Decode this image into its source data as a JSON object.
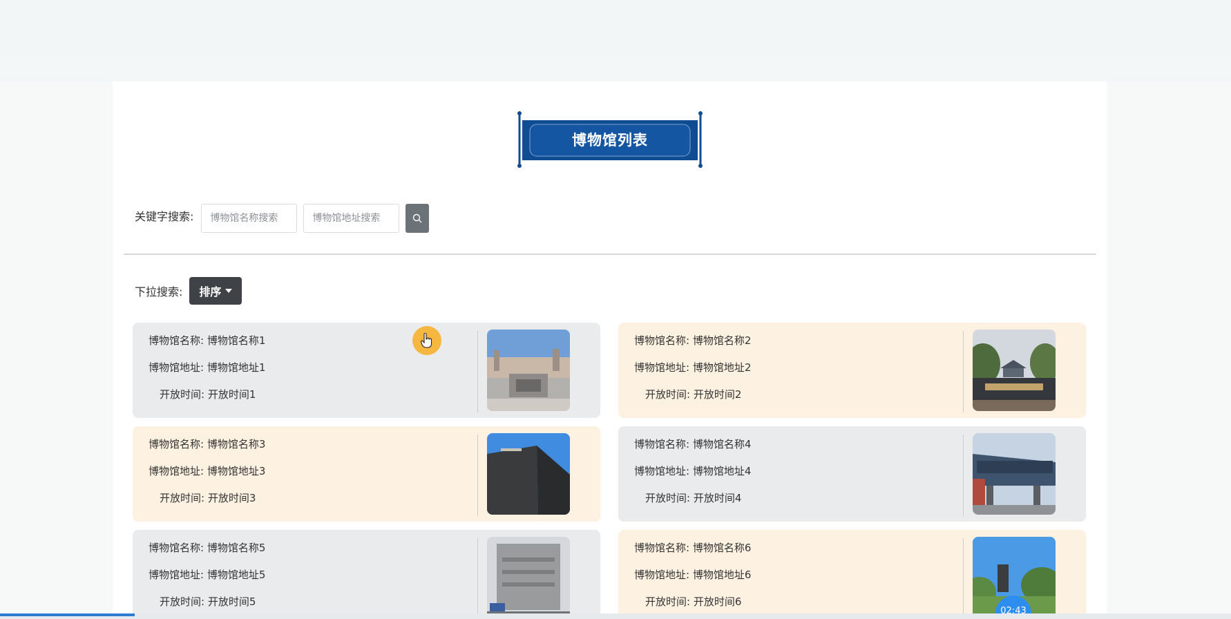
{
  "page": {
    "title": "博物馆列表"
  },
  "search": {
    "label": "关键字搜索:",
    "name_placeholder": "博物馆名称搜索",
    "address_placeholder": "博物馆地址搜索",
    "button_icon": "search-icon"
  },
  "dropdown": {
    "label": "下拉搜索:",
    "sort_label": "排序"
  },
  "colors": {
    "title_blue": "#0f4c92",
    "card_grey": "#e9ebec",
    "card_peach": "#fdf1e2",
    "cursor": "#f5b73f",
    "timer": "#2e8ef0"
  },
  "museums": [
    {
      "name_line": "博物馆名称: 博物馆名称1",
      "address_line": "博物馆地址: 博物馆地址1",
      "hours_line": "开放时间: 开放时间1",
      "style": "grey"
    },
    {
      "name_line": "博物馆名称: 博物馆名称2",
      "address_line": "博物馆地址: 博物馆地址2",
      "hours_line": "开放时间: 开放时间2",
      "style": "peach"
    },
    {
      "name_line": "博物馆名称: 博物馆名称3",
      "address_line": "博物馆地址: 博物馆地址3",
      "hours_line": "开放时间: 开放时间3",
      "style": "peach"
    },
    {
      "name_line": "博物馆名称: 博物馆名称4",
      "address_line": "博物馆地址: 博物馆地址4",
      "hours_line": "开放时间: 开放时间4",
      "style": "grey"
    },
    {
      "name_line": "博物馆名称: 博物馆名称5",
      "address_line": "博物馆地址: 博物馆地址5",
      "hours_line": "开放时间: 开放时间5",
      "style": "grey"
    },
    {
      "name_line": "博物馆名称: 博物馆名称6",
      "address_line": "博物馆地址: 博物馆地址6",
      "hours_line": "开放时间: 开放时间6",
      "style": "peach"
    }
  ],
  "recording": {
    "timer": "02:43",
    "cursor_icon": "hand-pointer-icon"
  }
}
